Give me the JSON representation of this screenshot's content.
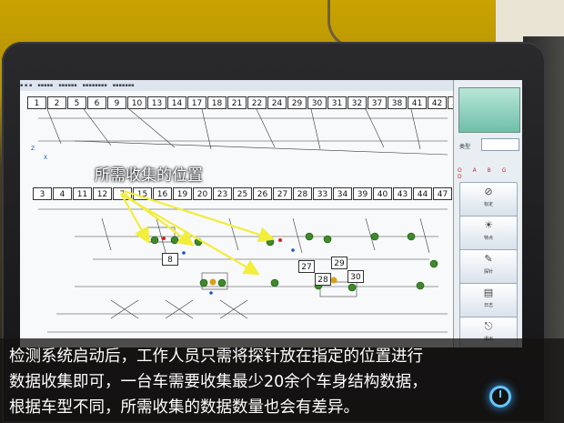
{
  "scene": {
    "annotation_label": "所需收集的位置",
    "caption_lines": [
      "检测系统启动后，工作人员只需将探针放在指定的位置进行",
      "数据收集即可，一台车需要收集最少20余个车身结构数据，",
      "根据车型不同，所需收集的数据数量也会有差异。"
    ],
    "arrow_color": "#f2ee3a",
    "point_color": "#2f8a1f"
  },
  "screen": {
    "top_row_numbers": [
      "1",
      "2",
      "5",
      "6",
      "9",
      "10",
      "13",
      "14",
      "17",
      "18",
      "21",
      "22",
      "24",
      "29",
      "30",
      "31",
      "32",
      "37",
      "38",
      "41",
      "42",
      "35",
      "36",
      "45",
      "46",
      "48"
    ],
    "mid_row_numbers": [
      "3",
      "4",
      "11",
      "12",
      "7",
      "15",
      "16",
      "19",
      "20",
      "23",
      "25",
      "26",
      "27",
      "28",
      "33",
      "34",
      "39",
      "40",
      "43",
      "44",
      "47",
      "49",
      "50"
    ],
    "lower_numbers": [
      "8",
      "27",
      "28",
      "29",
      "30"
    ],
    "axis_labels": [
      "Z",
      "X"
    ],
    "side_panel": {
      "field_label": "类型",
      "letters": "O A B G D",
      "tools": [
        {
          "icon": "target-icon",
          "label": "标定"
        },
        {
          "icon": "bulb-icon",
          "label": "特点"
        },
        {
          "icon": "probe-icon",
          "label": "探针"
        },
        {
          "icon": "doc-icon",
          "label": "日志"
        },
        {
          "icon": "exit-icon",
          "label": "退出"
        }
      ]
    }
  }
}
